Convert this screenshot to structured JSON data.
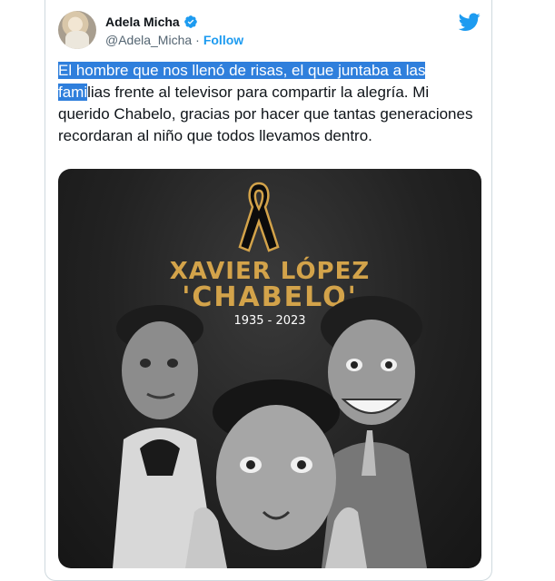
{
  "tweet": {
    "author_name": "Adela Micha",
    "handle": "@Adela_Micha",
    "separator": "·",
    "follow_label": "Follow",
    "text_highlighted": "El hombre que nos llenó de risas, el que juntaba a las fami",
    "text_rest": "lias frente al televisor para compartir la alegría. Mi querido Chabelo, gracias por hacer que tantas generaciones recordaran al niño que todos llevamos dentro."
  },
  "media": {
    "title_line1": "XAVIER LÓPEZ",
    "title_line2": "'CHABELO'",
    "years": "1935 - 2023"
  },
  "colors": {
    "accent": "#1d9bf0",
    "gold": "#d3a34a",
    "highlight": "#2f7fdc"
  },
  "icons": [
    "verified-badge-icon",
    "twitter-bird-icon",
    "mourning-ribbon-icon"
  ]
}
